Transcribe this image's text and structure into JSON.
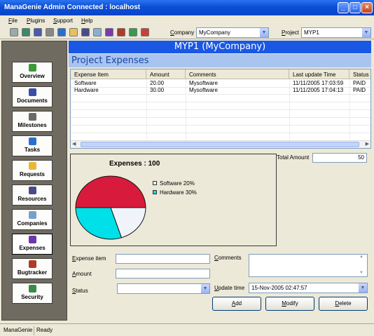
{
  "window": {
    "title": "ManaGenie Admin Connected : localhost"
  },
  "menu": [
    {
      "underline": "F",
      "rest": "ile"
    },
    {
      "underline": "P",
      "rest": "lugins"
    },
    {
      "underline": "S",
      "rest": "upport"
    },
    {
      "underline": "H",
      "rest": "elp"
    }
  ],
  "toolbar": {
    "company_label_u": "C",
    "company_label_rest": "ompany",
    "company_value": "MyCompany",
    "project_label_u": "P",
    "project_label_rest": "roject",
    "project_value": "MYP1",
    "icon_names": [
      "list-icon",
      "recycle-icon",
      "documents-icon",
      "milestones-icon",
      "tasks-icon",
      "folder-icon",
      "resources-icon",
      "companies-icon",
      "expenses-icon",
      "bugtracker-icon",
      "security-icon",
      "exit-icon"
    ]
  },
  "sidebar": {
    "items": [
      {
        "label": "Overview",
        "icon": "overview-icon",
        "color": "#3a9b3a"
      },
      {
        "label": "Documents",
        "icon": "documents-icon",
        "color": "#3a4da8"
      },
      {
        "label": "Milestones",
        "icon": "milestones-icon",
        "color": "#6a6a6a"
      },
      {
        "label": "Tasks",
        "icon": "tasks-icon",
        "color": "#2a6fd0"
      },
      {
        "label": "Requests",
        "icon": "requests-icon",
        "color": "#e8b83a"
      },
      {
        "label": "Resources",
        "icon": "resources-icon",
        "color": "#4a4a8a"
      },
      {
        "label": "Companies",
        "icon": "companies-icon",
        "color": "#7aa0c8"
      },
      {
        "label": "Expenses",
        "icon": "expenses-icon",
        "color": "#6a3aa8"
      },
      {
        "label": "Bugtracker",
        "icon": "bug-icon",
        "color": "#b03a2a"
      },
      {
        "label": "Security",
        "icon": "shield-icon",
        "color": "#3a8a4a"
      }
    ]
  },
  "header": {
    "title": "MYP1 (MyCompany)"
  },
  "section": {
    "title": "Project Expenses"
  },
  "grid": {
    "columns": [
      "Expense Item",
      "Amount",
      "Comments",
      "Last update Time",
      "Status"
    ],
    "rows": [
      [
        "Software",
        "20.00",
        "Mysoftware",
        "11/11/2005 17:03:59",
        "PAID"
      ],
      [
        "Hardware",
        "30.00",
        "Mysoftware",
        "11/11/2005 17:04:13",
        "PAID"
      ]
    ]
  },
  "chart_data": {
    "type": "pie",
    "title": "Expenses : 100",
    "slices": [
      {
        "label": "Software 20%",
        "value": 20,
        "color": "#f0f4fa"
      },
      {
        "label": "Hardware 30%",
        "value": 30,
        "color": "#00e0e8"
      },
      {
        "value": 50,
        "color": "#d81b3c"
      }
    ]
  },
  "total": {
    "label": "Total Amount",
    "value": "50"
  },
  "form": {
    "expense_item_label_u": "E",
    "expense_item_label_rest": "xpense item",
    "amount_label_u": "A",
    "amount_label_rest": "mount",
    "status_label_u": "S",
    "status_label_rest": "tatus",
    "comments_label_u": "C",
    "comments_label_rest": "omments",
    "update_time_label_u": "U",
    "update_time_label_rest": "pdate time",
    "update_time_value": "15-Nov-2005  02:47:57",
    "expense_item_value": "",
    "amount_value": "",
    "status_value": "",
    "comments_value": ""
  },
  "buttons": {
    "add_u": "A",
    "add_rest": "dd",
    "modify_u": "M",
    "modify_rest": "odify",
    "delete_u": "D",
    "delete_rest": "elete"
  },
  "statusbar": {
    "app": "ManaGenie",
    "status": "Ready"
  }
}
